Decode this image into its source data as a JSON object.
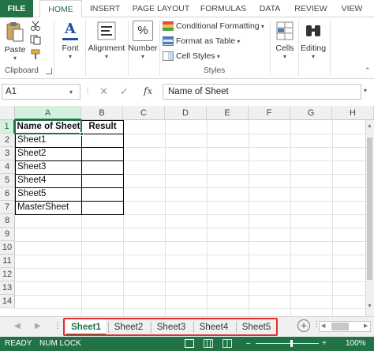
{
  "ribbon_tabs": {
    "file": "FILE",
    "home": "HOME",
    "insert": "INSERT",
    "page_layout": "PAGE LAYOUT",
    "formulas": "FORMULAS",
    "data": "DATA",
    "review": "REVIEW",
    "view": "VIEW"
  },
  "ribbon": {
    "paste": "Paste",
    "clipboard": "Clipboard",
    "font": "Font",
    "alignment": "Alignment",
    "number": "Number",
    "conditional_formatting": "Conditional Formatting",
    "format_as_table": "Format as Table",
    "cell_styles": "Cell Styles",
    "styles": "Styles",
    "cells": "Cells",
    "editing": "Editing",
    "percent_symbol": "%"
  },
  "formula_bar": {
    "name_box": "A1",
    "fx": "fx",
    "content": "Name of Sheet"
  },
  "columns": [
    "A",
    "B",
    "C",
    "D",
    "E",
    "F",
    "G",
    "H"
  ],
  "rows": [
    "1",
    "2",
    "3",
    "4",
    "5",
    "6",
    "7",
    "8",
    "9",
    "10",
    "11",
    "12",
    "13",
    "14"
  ],
  "table": {
    "header_a": "Name of Sheet",
    "header_b": "Result",
    "names": [
      "Sheet1",
      "Sheet2",
      "Sheet3",
      "Sheet4",
      "Sheet5",
      "MasterSheet"
    ]
  },
  "sheet_tabs": [
    "Sheet1",
    "Sheet2",
    "Sheet3",
    "Sheet4",
    "Sheet5"
  ],
  "status": {
    "ready": "READY",
    "num_lock": "NUM LOCK",
    "zoom": "100%",
    "minus": "–",
    "plus": "+"
  },
  "colors": {
    "excel_green": "#217346",
    "highlight_red": "#e03030"
  }
}
